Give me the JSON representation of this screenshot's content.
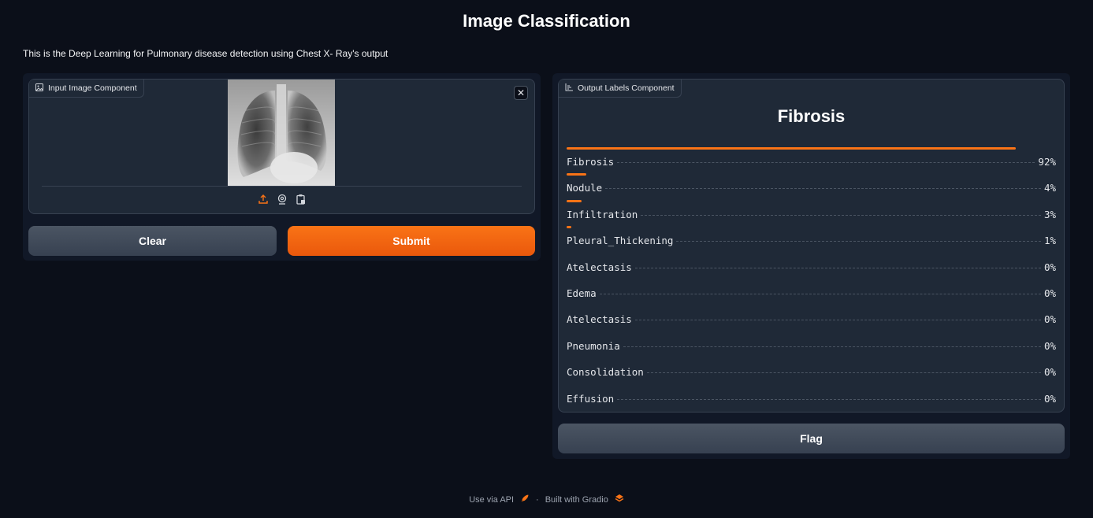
{
  "page": {
    "title": "Image Classification",
    "description": "This is the Deep Learning for Pulmonary disease detection using Chest X- Ray's output"
  },
  "input": {
    "label": "Input Image Component",
    "label_icon": "image-icon",
    "close_icon": "close-icon",
    "source_icons": [
      "upload-icon",
      "webcam-icon",
      "clipboard-icon"
    ]
  },
  "buttons": {
    "clear": "Clear",
    "submit": "Submit",
    "flag": "Flag"
  },
  "output": {
    "label": "Output Labels Component",
    "label_icon": "bar-chart-icon",
    "top_label": "Fibrosis",
    "confidences": [
      {
        "label": "Fibrosis",
        "value": 0.92,
        "text": "92%"
      },
      {
        "label": "Nodule",
        "value": 0.04,
        "text": "4%"
      },
      {
        "label": "Infiltration",
        "value": 0.03,
        "text": "3%"
      },
      {
        "label": "Pleural_Thickening",
        "value": 0.01,
        "text": "1%"
      },
      {
        "label": "Atelectasis",
        "value": 0.0,
        "text": "0%"
      },
      {
        "label": "Edema",
        "value": 0.0,
        "text": "0%"
      },
      {
        "label": "Atelectasis",
        "value": 0.0,
        "text": "0%"
      },
      {
        "label": "Pneumonia",
        "value": 0.0,
        "text": "0%"
      },
      {
        "label": "Consolidation",
        "value": 0.0,
        "text": "0%"
      },
      {
        "label": "Effusion",
        "value": 0.0,
        "text": "0%"
      }
    ]
  },
  "footer": {
    "api": "Use via API",
    "separator": "·",
    "built_with": "Built with Gradio",
    "api_icon": "rocket-icon",
    "gradio_icon": "gradio-logo-icon"
  },
  "colors": {
    "background": "#0b0f19",
    "panel": "#1f2937",
    "accent": "#f97316"
  }
}
